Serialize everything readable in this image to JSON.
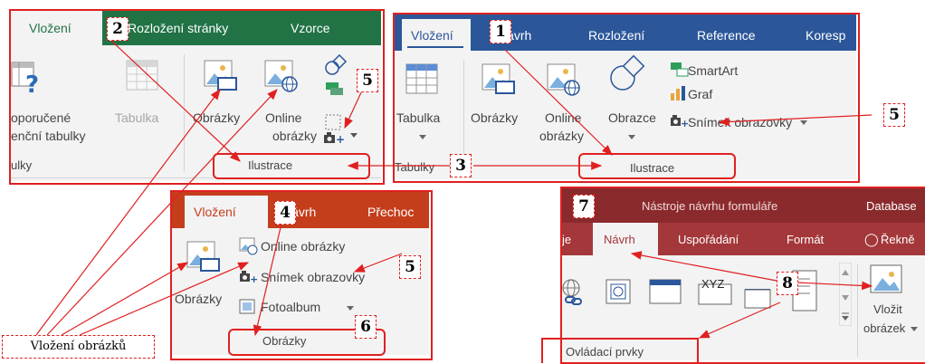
{
  "callout": {
    "label": "Vložení obrázků"
  },
  "markers": {
    "m1": "1",
    "m2": "2",
    "m3": "3",
    "m4": "4",
    "m5a": "5",
    "m5b": "5",
    "m5c": "5",
    "m6": "6",
    "m7": "7",
    "m8": "8"
  },
  "ribbon_a": {
    "tabs": [
      "Vložení",
      "Rozložení stránky",
      "Vzorce"
    ],
    "buttons": {
      "recommended_line1": "oporučené",
      "recommended_line2": "enční tabulky",
      "table": "Tabulka",
      "pictures": "Obrázky",
      "online_line1": "Online",
      "online_line2": "obrázky"
    },
    "groups": {
      "tables": "ulky",
      "illustrations": "Ilustrace"
    },
    "accent": "#217346"
  },
  "ribbon_b": {
    "tabs": [
      "Vložení",
      "Návrh",
      "Rozložení",
      "Reference",
      "Koresp"
    ],
    "buttons": {
      "table": "Tabulka",
      "pictures": "Obrázky",
      "online_line1": "Online",
      "online_line2": "obrázky",
      "shapes": "Obrazce",
      "smartart": "SmartArt",
      "chart": "Graf",
      "screenshot": "Snímek obrazovky"
    },
    "groups": {
      "tables": "Tabulky",
      "illustrations": "Ilustrace"
    },
    "accent": "#2b579a"
  },
  "ribbon_c": {
    "tabs": [
      "Vložení",
      "Návrh",
      "Přechoc"
    ],
    "buttons": {
      "pictures": "Obrázky",
      "online": "Online obrázky",
      "screenshot": "Snímek obrazovky",
      "photo_album": "Fotoalbum"
    },
    "groups": {
      "images": "Obrázky"
    },
    "accent": "#c43e1c"
  },
  "ribbon_d": {
    "title": "Nástroje návrhu formuláře",
    "title_right": "Database",
    "tabs": [
      "je",
      "Návrh",
      "Uspořádání",
      "Formát"
    ],
    "tell_me": "Řekně",
    "controls": {
      "xyz": "XYZ"
    },
    "buttons": {
      "insert_image_line1": "Vložit",
      "insert_image_line2": "obrázek"
    },
    "groups": {
      "controls": "Ovládací prvky"
    },
    "accent": "#a4373a"
  }
}
